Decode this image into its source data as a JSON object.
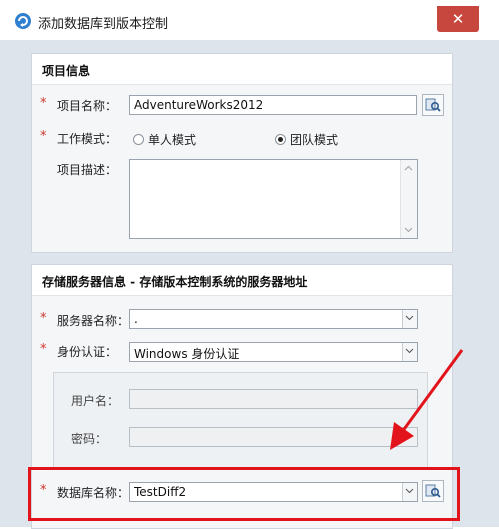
{
  "window": {
    "title": "添加数据库到版本控制",
    "close_symbol": "✕",
    "app_icon": "refresh-logo-icon"
  },
  "project_section": {
    "title": "项目信息",
    "required_mark": "*",
    "project_name_label": "项目名称：",
    "project_name_value": "AdventureWorks2012",
    "work_mode_label": "工作模式：",
    "mode_single": "单人模式",
    "mode_team": "团队模式",
    "selected_mode": "团队模式",
    "description_label": "项目描述：",
    "description_value": ""
  },
  "server_section": {
    "title": "存储服务器信息 - 存储版本控制系统的服务器地址",
    "required_mark": "*",
    "server_name_label": "服务器名称：",
    "server_name_value": ".",
    "auth_label": "身份认证：",
    "auth_value": "Windows 身份认证",
    "username_label": "用户名：",
    "username_value": "",
    "password_label": "密码：",
    "password_value": "",
    "database_name_label": "数据库名称：",
    "database_name_value": "TestDiff2"
  },
  "colors": {
    "close_button": "#c7463d",
    "required_mark": "#d0342c",
    "annotation": "#e3131b",
    "dialog_background": "#dde4ec"
  }
}
